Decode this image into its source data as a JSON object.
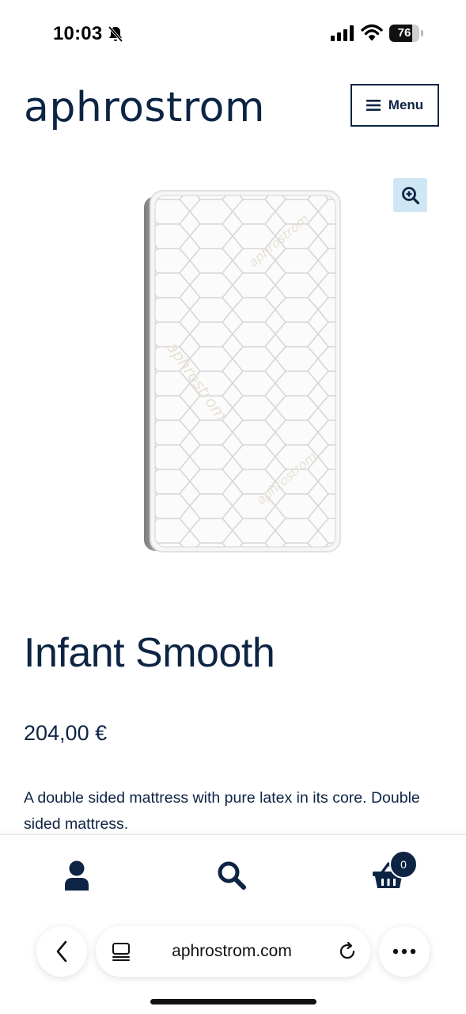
{
  "status_bar": {
    "time": "10:03",
    "battery": "76",
    "battery_level": 0.76
  },
  "header": {
    "logo": "aphrostrom",
    "menu_label": "Menu"
  },
  "product": {
    "title": "Infant Smooth",
    "price": "204,00 €",
    "description": "A double sided mattress with pure latex in its core. Double sided mattress."
  },
  "bottom_nav": {
    "cart_count": "0"
  },
  "browser": {
    "url": "aphrostrom.com"
  },
  "colors": {
    "brand": "#0d2444",
    "zoom_bg": "#cfe6f4"
  },
  "icons": [
    "bell-slash-icon",
    "signal-icon",
    "wifi-icon",
    "hamburger-icon",
    "zoom-in-icon",
    "user-icon",
    "search-icon",
    "cart-icon",
    "chevron-left-icon",
    "tabs-icon",
    "reload-icon",
    "more-icon"
  ]
}
